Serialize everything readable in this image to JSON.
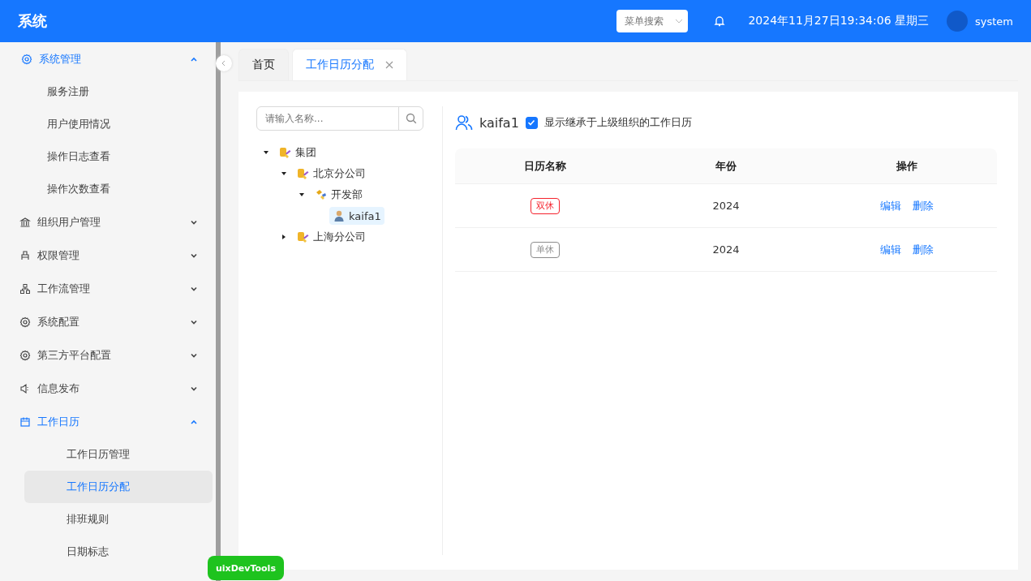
{
  "header": {
    "title": "系统",
    "menu_search": {
      "placeholder": "菜单搜索"
    },
    "datetime": "2024年11月27日19:34:06 星期三",
    "user": "system"
  },
  "sidebar": {
    "items": [
      {
        "label": "系统管理",
        "kind": "gear",
        "expanded": true,
        "active": true,
        "children": [
          {
            "label": "服务注册",
            "selected": false
          },
          {
            "label": "用户使用情况",
            "selected": false
          },
          {
            "label": "操作日志查看",
            "selected": false
          },
          {
            "label": "操作次数查看",
            "selected": false
          }
        ]
      },
      {
        "label": "组织用户管理",
        "kind": "bank",
        "expanded": false,
        "active": false
      },
      {
        "label": "权限管理",
        "kind": "stamp",
        "expanded": false,
        "active": false
      },
      {
        "label": "工作流管理",
        "kind": "flow",
        "expanded": false,
        "active": false
      },
      {
        "label": "系统配置",
        "kind": "gear",
        "expanded": false,
        "active": false
      },
      {
        "label": "第三方平台配置",
        "kind": "gear",
        "expanded": false,
        "active": false
      },
      {
        "label": "信息发布",
        "kind": "speaker",
        "expanded": false,
        "active": false
      },
      {
        "label": "工作日历",
        "kind": "calendar",
        "expanded": true,
        "active": true,
        "children": [
          {
            "label": "工作日历管理",
            "selected": false
          },
          {
            "label": "工作日历分配",
            "selected": true
          },
          {
            "label": "排班规则",
            "selected": false
          },
          {
            "label": "日期标志",
            "selected": false
          }
        ]
      }
    ]
  },
  "tabs": [
    {
      "label": "首页",
      "selected": false,
      "closable": false
    },
    {
      "label": "工作日历分配",
      "selected": true,
      "closable": true
    }
  ],
  "tree_search": {
    "placeholder": "请输入名称..."
  },
  "tree": [
    {
      "label": "集团",
      "kind": "org",
      "expanded": true,
      "selected": false,
      "children": [
        {
          "label": "北京分公司",
          "kind": "org",
          "expanded": true,
          "selected": false,
          "children": [
            {
              "label": "开发部",
              "kind": "dept",
              "expanded": true,
              "selected": false,
              "children": [
                {
                  "label": "kaifa1",
                  "kind": "user",
                  "selected": true
                }
              ]
            }
          ]
        },
        {
          "label": "上海分公司",
          "kind": "org",
          "expanded": false,
          "selected": false
        }
      ]
    }
  ],
  "detail": {
    "user": "kaifa1",
    "inherit_checkbox": {
      "label": "显示继承于上级组织的工作日历",
      "checked": true
    }
  },
  "table": {
    "columns": [
      "日历名称",
      "年份",
      "操作"
    ],
    "rows": [
      {
        "name": "双休",
        "color": "#f5222d",
        "year": "2024",
        "actions": [
          "编辑",
          "删除"
        ]
      },
      {
        "name": "单休",
        "color": "#8c8c8c",
        "year": "2024",
        "actions": [
          "编辑",
          "删除"
        ]
      }
    ]
  },
  "devtools_badge": "uixDevTools"
}
